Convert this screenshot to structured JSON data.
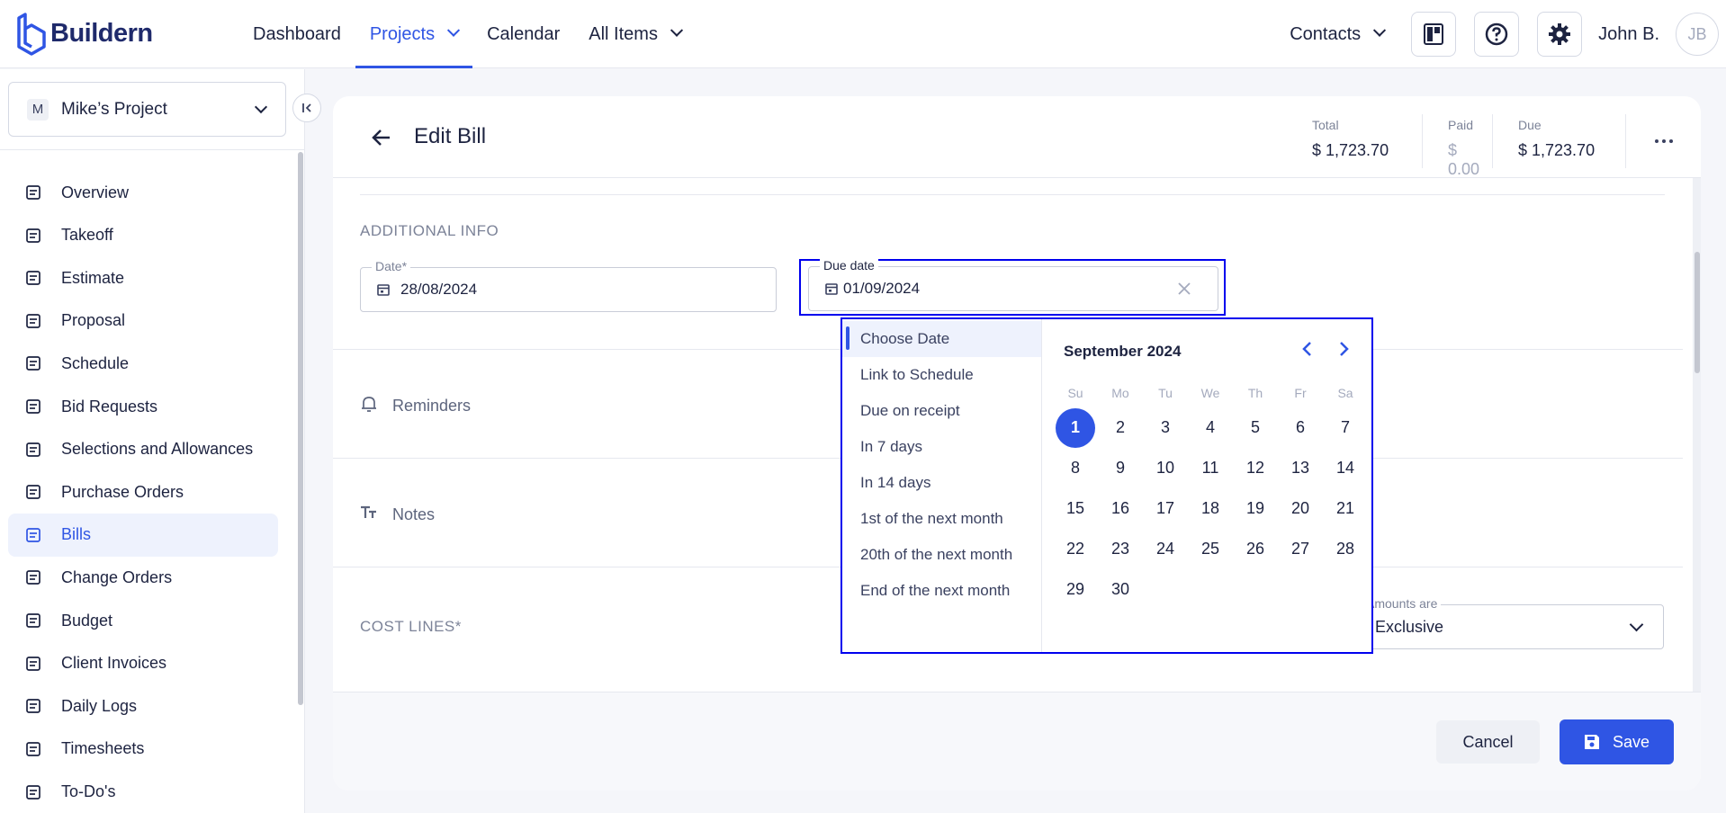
{
  "app": {
    "logo_text": "Buildern"
  },
  "nav": {
    "dashboard": "Dashboard",
    "projects": "Projects",
    "calendar": "Calendar",
    "all_items": "All Items",
    "contacts": "Contacts",
    "user_name": "John B.",
    "user_initials": "JB"
  },
  "sidebar": {
    "project_badge": "M",
    "project_name": "Mike’s Project",
    "items": [
      {
        "label": "Overview",
        "icon": "presentation-icon"
      },
      {
        "label": "Takeoff",
        "icon": "ruler-compass-icon"
      },
      {
        "label": "Estimate",
        "icon": "calculator-icon"
      },
      {
        "label": "Proposal",
        "icon": "document-icon"
      },
      {
        "label": "Schedule",
        "icon": "calendar-icon"
      },
      {
        "label": "Bid Requests",
        "icon": "gavel-icon"
      },
      {
        "label": "Selections and Allowances",
        "icon": "list-icon"
      },
      {
        "label": "Purchase Orders",
        "icon": "cart-icon"
      },
      {
        "label": "Bills",
        "icon": "bill-icon",
        "active": true
      },
      {
        "label": "Change Orders",
        "icon": "change-order-icon"
      },
      {
        "label": "Budget",
        "icon": "budget-icon"
      },
      {
        "label": "Client Invoices",
        "icon": "invoice-icon"
      },
      {
        "label": "Daily Logs",
        "icon": "daily-log-icon"
      },
      {
        "label": "Timesheets",
        "icon": "timesheet-icon"
      },
      {
        "label": "To-Do's",
        "icon": "checklist-icon"
      }
    ]
  },
  "page": {
    "title": "Edit Bill",
    "totals": {
      "total_label": "Total",
      "total_value": "$ 1,723.70",
      "paid_label": "Paid",
      "paid_value": "$ 0.00",
      "due_label": "Due",
      "due_value": "$ 1,723.70"
    },
    "additional_info": "ADDITIONAL INFO",
    "date_label": "Date*",
    "date_value": "28/08/2024",
    "due_date_label": "Due date",
    "due_date_value": "01/09/2024",
    "reminders": "Reminders",
    "notes": "Notes",
    "cost_lines": "COST LINES*",
    "amounts_label": "Amounts are",
    "amounts_value": "Exclusive",
    "cancel": "Cancel",
    "save": "Save"
  },
  "picker": {
    "options": [
      "Choose Date",
      "Link to Schedule",
      "Due on receipt",
      "In 7 days",
      "In 14 days",
      "1st of the next month",
      "20th of the next month",
      "End of the next month"
    ],
    "month_title": "September 2024",
    "weekdays": [
      "Su",
      "Mo",
      "Tu",
      "We",
      "Th",
      "Fr",
      "Sa"
    ],
    "days": [
      "1",
      "2",
      "3",
      "4",
      "5",
      "6",
      "7",
      "8",
      "9",
      "10",
      "11",
      "12",
      "13",
      "14",
      "15",
      "16",
      "17",
      "18",
      "19",
      "20",
      "21",
      "22",
      "23",
      "24",
      "25",
      "26",
      "27",
      "28",
      "29",
      "30"
    ],
    "selected_day": "1"
  },
  "colors": {
    "accent": "#2f55e4",
    "highlight_border": "#0000ee"
  }
}
